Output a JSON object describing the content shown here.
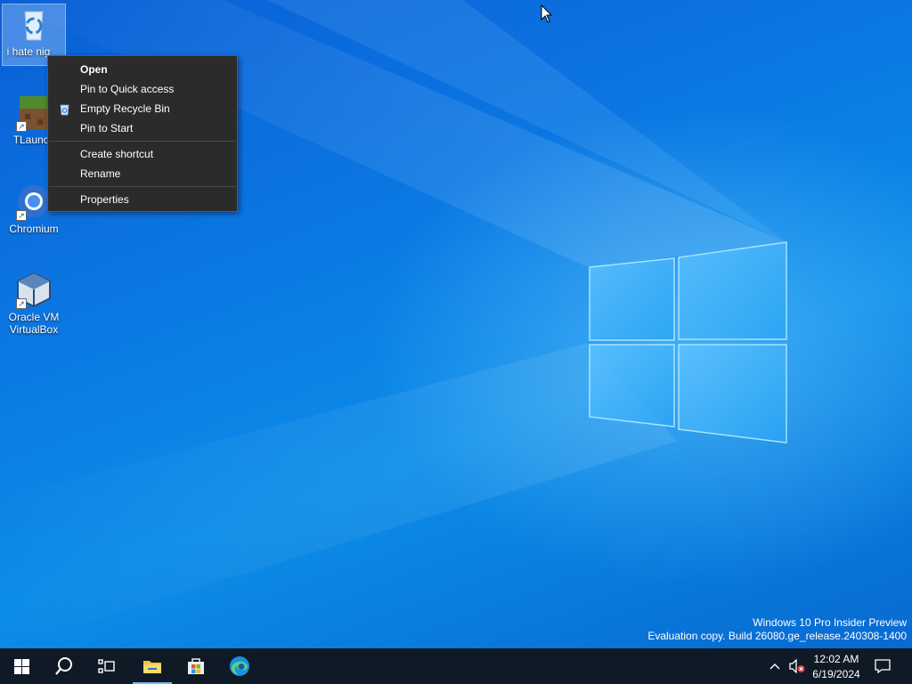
{
  "desktop": {
    "icons": [
      {
        "label": "i hate nig",
        "icon": "recycle-bin-icon"
      },
      {
        "label": "TLaunch",
        "icon": "tlauncher-icon"
      },
      {
        "label": "Chromium",
        "icon": "chromium-icon"
      },
      {
        "label": "Oracle VM VirtualBox",
        "icon": "virtualbox-icon"
      }
    ]
  },
  "context_menu": {
    "items": [
      {
        "label": "Open"
      },
      {
        "label": "Pin to Quick access"
      },
      {
        "label": "Empty Recycle Bin",
        "icon": "recycle-bin-small-icon"
      },
      {
        "label": "Pin to Start"
      },
      {
        "label": "Create shortcut"
      },
      {
        "label": "Rename"
      },
      {
        "label": "Properties"
      }
    ]
  },
  "watermark": {
    "line1": "Windows 10 Pro Insider Preview",
    "line2": "Evaluation copy. Build 26080.ge_release.240308-1400"
  },
  "taskbar": {
    "buttons": [
      "start-icon",
      "search-icon",
      "task-view-icon",
      "file-explorer-icon",
      "microsoft-store-icon",
      "edge-icon"
    ],
    "clock": {
      "time": "12:02 AM",
      "date": "6/19/2024"
    }
  },
  "colors": {
    "wallpaper": "#0b78e3",
    "taskbar": "#101a26",
    "menu_bg": "#2b2b2b"
  }
}
